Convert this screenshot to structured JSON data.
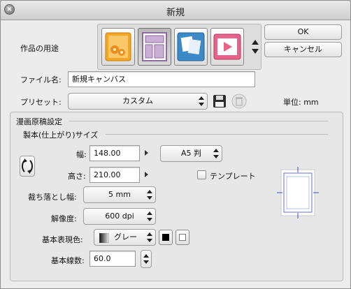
{
  "window": {
    "title": "新規"
  },
  "purpose": {
    "label": "作品の用途",
    "options": [
      {
        "name": "illustration-icon",
        "color": "#f5a623"
      },
      {
        "name": "comic-icon",
        "color": "#b79ac4"
      },
      {
        "name": "multi-page-icon",
        "color": "#3c89c8"
      },
      {
        "name": "animation-icon",
        "color": "#e8628a"
      }
    ],
    "selected_index": 1
  },
  "buttons": {
    "ok": "OK",
    "cancel": "キャンセル"
  },
  "file": {
    "label": "ファイル名:",
    "value": "新規キャンバス"
  },
  "preset": {
    "label": "プリセット:",
    "value": "カスタム",
    "unit_label": "単位: mm"
  },
  "manga": {
    "section_title": "漫画原稿設定",
    "binding_title": "製本(仕上がり)サイズ",
    "width": {
      "label": "幅:",
      "value": "148.00"
    },
    "height": {
      "label": "高さ:",
      "value": "210.00"
    },
    "size_preset": "A5 判",
    "template_label": "テンプレート",
    "template_checked": false,
    "bleed": {
      "label": "裁ち落とし幅:",
      "value": "5 mm"
    },
    "resolution": {
      "label": "解像度:",
      "value": "600 dpi"
    },
    "color_mode": {
      "label": "基本表現色:",
      "value": "グレー"
    },
    "line_count": {
      "label": "基本線数:",
      "value": "60.0"
    }
  }
}
